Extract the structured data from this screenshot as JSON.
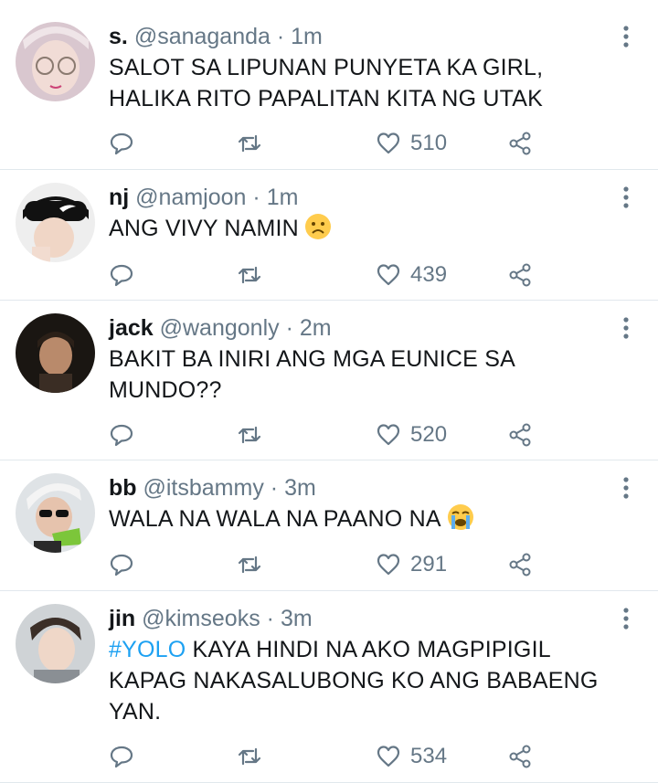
{
  "tweets": [
    {
      "name": "s.",
      "handle": "@sanaganda",
      "separator": "·",
      "time": "1m",
      "text_parts": [
        "SALOT SA LIPUNAN PUNYETA KA GIRL, HALIKA RITO PAPALITAN KITA NG UTAK"
      ],
      "likes": "510",
      "avatar": "girl-with-glasses-avatar"
    },
    {
      "name": "nj",
      "handle": "@namjoon",
      "separator": "·",
      "time": "1m",
      "text_parts": [
        "ANG VIVY NAMIN"
      ],
      "emoji": "frowning-face-emoji",
      "likes": "439",
      "avatar": "person-with-cap-avatar"
    },
    {
      "name": "jack",
      "handle": "@wangonly",
      "separator": "·",
      "time": "2m",
      "text_parts": [
        "BAKIT BA INIRI ANG MGA EUNICE SA MUNDO??"
      ],
      "likes": "520",
      "avatar": "dark-portrait-avatar"
    },
    {
      "name": "bb",
      "handle": "@itsbammy",
      "separator": "·",
      "time": "3m",
      "text_parts": [
        "WALA NA WALA NA PAANO NA"
      ],
      "emoji": "loudly-crying-face-emoji",
      "likes": "291",
      "avatar": "silver-hair-sunglasses-avatar"
    },
    {
      "name": "jin",
      "handle": "@kimseoks",
      "separator": "·",
      "time": "3m",
      "hashtag": "#YOLO",
      "text_parts": [
        " KAYA HINDI NA AKO MAGPIPIGIL KAPAG NAKASALUBONG KO ANG BABAENG YAN."
      ],
      "likes": "534",
      "avatar": "man-portrait-avatar"
    }
  ],
  "colors": {
    "text": "#14171a",
    "secondary": "#657786",
    "hashtag": "#1da1f2",
    "divider": "#e1e8ed"
  }
}
